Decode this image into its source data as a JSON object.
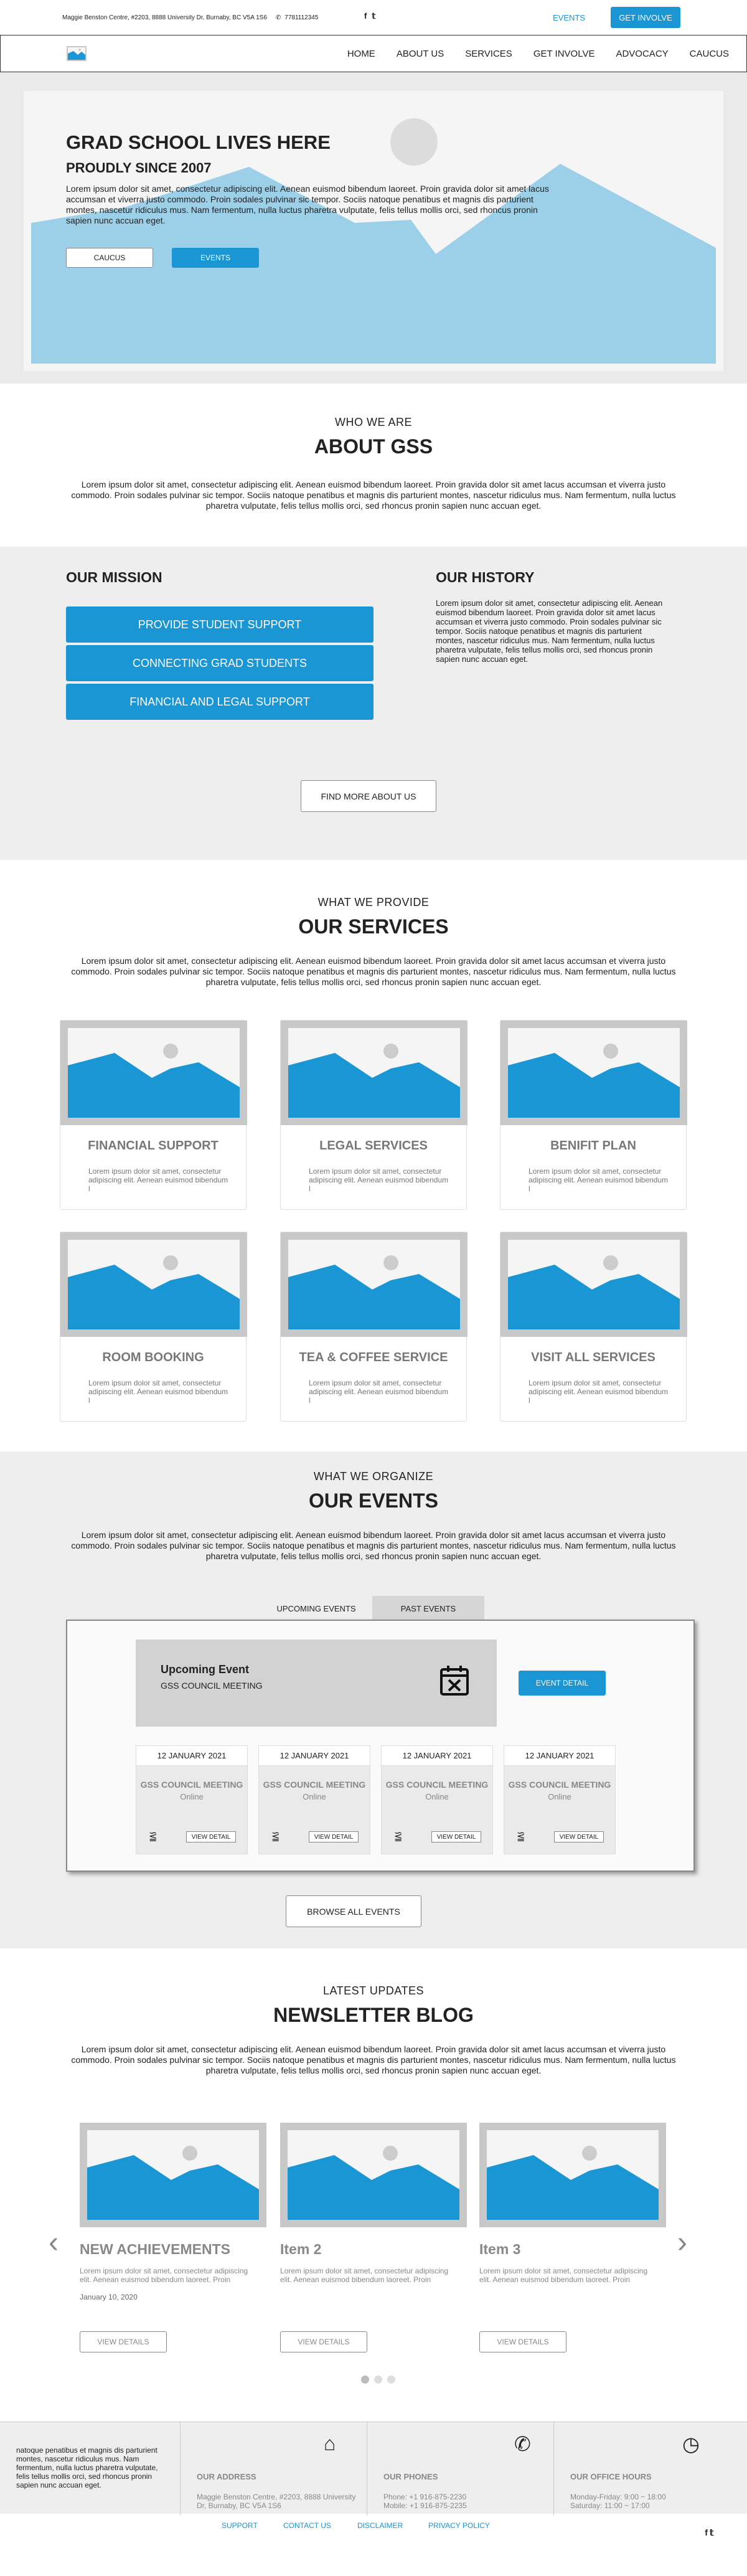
{
  "topbar": {
    "address": "Maggie Benston Centre, #2203, 8888 University Dr, Burnaby, BC V5A 1S6",
    "phone": "7781112345",
    "events_link": "EVENTS",
    "involve_button": "GET INVOLVE"
  },
  "nav": {
    "items": [
      "HOME",
      "ABOUT US",
      "SERVICES",
      "GET INVOLVE",
      "ADVOCACY",
      "CAUCUS"
    ]
  },
  "hero": {
    "title": "GRAD SCHOOL LIVES HERE",
    "subtitle": "PROUDLY SINCE 2007",
    "text": "Lorem ipsum dolor sit amet, consectetur adipiscing elit. Aenean euismod bibendum laoreet. Proin gravida dolor sit amet lacus accumsan et viverra justo commodo. Proin sodales pulvinar sic tempor. Sociis natoque penatibus et magnis dis parturient montes, nascetur ridiculus mus. Nam fermentum, nulla luctus pharetra vulputate, felis tellus mollis orci, sed rhoncus pronin sapien nunc accuan eget.",
    "caucus_button": "CAUCUS",
    "events_button": "EVENTS"
  },
  "about": {
    "eyebrow": "WHO WE ARE",
    "title": "ABOUT GSS",
    "text": "Lorem ipsum dolor sit amet, consectetur adipiscing elit. Aenean euismod bibendum laoreet. Proin gravida dolor sit amet lacus accumsan et viverra justo commodo. Proin sodales pulvinar sic tempor. Sociis natoque penatibus et magnis dis parturient montes, nascetur ridiculus mus. Nam fermentum, nulla luctus pharetra vulputate, felis tellus mollis orci, sed rhoncus pronin sapien nunc accuan eget."
  },
  "mission": {
    "title": "OUR MISSION",
    "buttons": [
      "PROVIDE STUDENT SUPPORT",
      "CONNECTING GRAD STUDENTS",
      "FINANCIAL AND LEGAL SUPPORT"
    ],
    "history_title": "OUR HISTORY",
    "history_text": "Lorem ipsum dolor sit amet, consectetur adipiscing elit. Aenean euismod bibendum laoreet. Proin gravida dolor sit amet lacus accumsan et viverra justo commodo. Proin sodales pulvinar sic tempor. Sociis natoque penatibus et magnis dis parturient montes, nascetur ridiculus mus. Nam fermentum, nulla luctus pharetra vulputate, felis tellus mollis orci, sed rhoncus pronin sapien nunc accuan eget.",
    "find_more_button": "FIND MORE ABOUT US"
  },
  "services": {
    "eyebrow": "WHAT WE PROVIDE",
    "title": "OUR SERVICES",
    "text": "Lorem ipsum dolor sit amet, consectetur adipiscing elit. Aenean euismod bibendum laoreet. Proin gravida dolor sit amet lacus accumsan et viverra justo commodo. Proin sodales pulvinar sic tempor. Sociis natoque penatibus et magnis dis parturient montes, nascetur ridiculus mus. Nam fermentum, nulla luctus pharetra vulputate, felis tellus mollis orci, sed rhoncus pronin sapien nunc accuan eget.",
    "card_text": "Lorem ipsum dolor sit amet, consectetur adipiscing elit. Aenean euismod bibendum l",
    "cards": [
      "FINANCIAL SUPPORT",
      "LEGAL SERVICES",
      "BENIFIT PLAN",
      "ROOM BOOKING",
      "TEA & COFFEE SERVICE",
      "VISIT ALL SERVICES"
    ]
  },
  "events": {
    "eyebrow": "WHAT WE ORGANIZE",
    "title": "OUR EVENTS",
    "text": "Lorem ipsum dolor sit amet, consectetur adipiscing elit. Aenean euismod bibendum laoreet. Proin gravida dolor sit amet lacus accumsan et viverra justo commodo. Proin sodales pulvinar sic tempor. Sociis natoque penatibus et magnis dis parturient montes, nascetur ridiculus mus. Nam fermentum, nulla luctus pharetra vulputate, felis tellus mollis orci, sed rhoncus pronin sapien nunc accuan eget.",
    "tabs": [
      "UPCOMING EVENTS",
      "PAST EVENTS"
    ],
    "upcoming_title": "Upcoming Event",
    "upcoming_subtitle": "GSS COUNCIL MEETING",
    "event_detail_button": "EVENT DETAIL",
    "mini_date": "12 JANUARY 2021",
    "mini_title": "GSS COUNCIL MEETING",
    "mini_location": "Online",
    "view_detail": "VIEW DETAIL",
    "browse_button": "BROWSE ALL EVENTS"
  },
  "blog": {
    "eyebrow": "LATEST UPDATES",
    "title": "NEWSLETTER BLOG",
    "text": "Lorem ipsum dolor sit amet, consectetur adipiscing elit. Aenean euismod bibendum laoreet. Proin gravida dolor sit amet lacus accumsan et viverra justo commodo. Proin sodales pulvinar sic tempor. Sociis natoque penatibus et magnis dis parturient montes, nascetur ridiculus mus. Nam fermentum, nulla luctus pharetra vulputate, felis tellus mollis orci, sed rhoncus pronin sapien nunc accuan eget.",
    "card_text": "Lorem ipsum dolor sit amet, consectetur adipiscing elit. Aenean euismod bibendum laoreet. Proin",
    "items": [
      "NEW ACHIEVEMENTS",
      "Item 2",
      "Item 3"
    ],
    "date": "January 10, 2020",
    "view_details": "VIEW DETAILS"
  },
  "footer": {
    "left_text": "natoque penatibus et magnis dis parturient montes, nascetur ridiculus mus. Nam fermentum, nulla luctus pharetra vulputate, felis tellus mollis orci, sed rhoncus pronin sapien nunc accuan eget.",
    "address_title": "OUR ADDRESS",
    "address": "Maggie Benston Centre, #2203, 8888 University Dr, Burnaby, BC V5A 1S6",
    "phones_title": "OUR PHONES",
    "phone1": "Phone: +1 916-875-2230",
    "phone2": "Mobile: +1 916-875-2235",
    "hours_title": "OUR OFFICE HOURS",
    "hours1": "Monday-Friday: 9:00 ~ 18:00",
    "hours2": "Saturday: 11:00 ~ 17:00",
    "links": [
      "SUPPORT",
      "CONTACT US",
      "DISCLAIMER",
      "PRIVACY POLICY"
    ]
  },
  "colors": {
    "accent": "#1a96d4",
    "section_bg": "#eeeeee"
  }
}
